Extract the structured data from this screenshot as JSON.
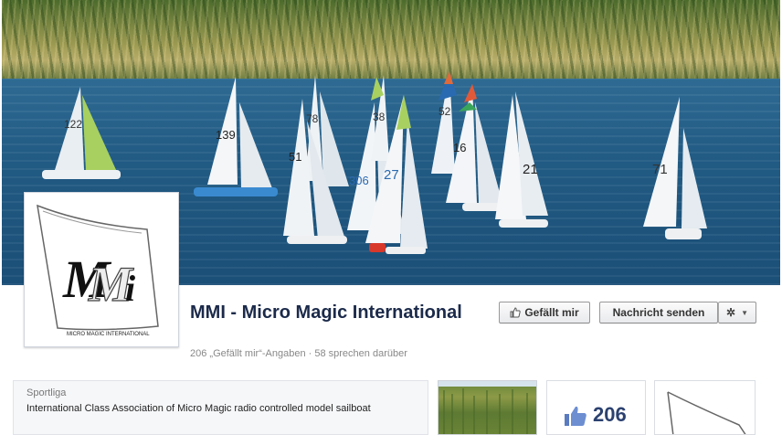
{
  "page": {
    "name": "MMI - Micro Magic International",
    "stats": {
      "likes_text": "206 „Gefällt mir“-Angaben",
      "separator": "·",
      "talking_text": "58 sprechen darüber"
    }
  },
  "profile_logo": {
    "caption": "MICRO MAGIC INTERNATIONAL"
  },
  "actions": {
    "like_label": "Gefällt mir",
    "message_label": "Nachricht senden",
    "gear_icon": "gear-icon",
    "dropdown_icon": "caret-down-icon"
  },
  "info": {
    "category": "Sportliga",
    "description": "International Class Association of Micro Magic radio controlled model sailboat"
  },
  "tiles": {
    "likes_count": "206"
  },
  "cover": {
    "sail_numbers": [
      "122",
      "139",
      "78",
      "51",
      "306",
      "38",
      "52",
      "16",
      "21",
      "27",
      "71"
    ]
  }
}
